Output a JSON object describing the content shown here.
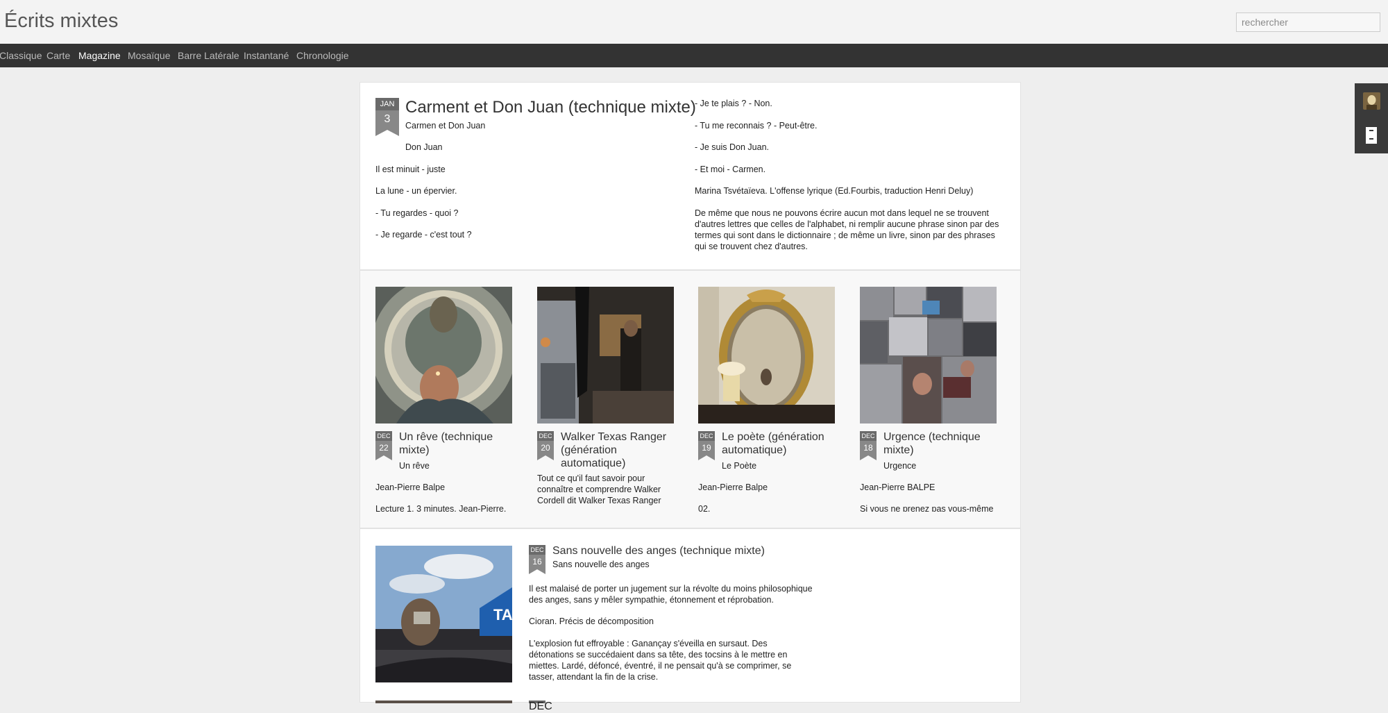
{
  "header": {
    "site_title": "Écrits mixtes",
    "search_placeholder": "rechercher"
  },
  "nav": [
    {
      "label": "Classique",
      "active": false
    },
    {
      "label": "Carte",
      "active": false
    },
    {
      "label": "Magazine",
      "active": true
    },
    {
      "label": "Mosaïque",
      "active": false
    },
    {
      "label": "Barre Latérale",
      "active": false
    },
    {
      "label": "Instantané",
      "active": false
    },
    {
      "label": "Chronologie",
      "active": false
    }
  ],
  "featured": {
    "month": "JAN",
    "day": "3",
    "title": "Carment et Don Juan (technique mixte)",
    "subtitle": "Carmen et Don Juan",
    "left_paragraphs": [
      "Don Juan",
      "Il est minuit - juste",
      "La lune - un épervier.",
      "- Tu regardes - quoi ?",
      "- Je regarde - c'est tout ?"
    ],
    "right_paragraphs": [
      "- Je te plais ? - Non.",
      "- Tu me reconnais ? - Peut-être.",
      "- Je suis Don Juan.",
      "- Et moi - Carmen.",
      "Marina Tsvétaïeva. L'offense lyrique (Ed.Fourbis, traduction Henri Deluy)",
      "De même que nous ne pouvons écrire aucun mot dans lequel ne se trouvent d'autres lettres que celles de l'alphabet, ni remplir aucune phrase sinon par des termes qui sont dans le dictionnaire ; de même un livre, sinon par des phrases qui se trouvent chez d'autres."
    ]
  },
  "grid_posts": [
    {
      "month": "DEC",
      "day": "22",
      "title": "Un rêve (technique mixte)",
      "subtitle": "Un rêve",
      "paragraphs": [
        "Jean-Pierre Balpe",
        "Lecture 1. 3 minutes. Jean-Pierre."
      ]
    },
    {
      "month": "DEC",
      "day": "20",
      "title": "Walker Texas Ranger (génération automatique)",
      "subtitle": "",
      "paragraphs": [
        "Tout ce qu'il faut savoir pour connaître et comprendre Walker Cordell dit Walker Texas Ranger"
      ]
    },
    {
      "month": "DEC",
      "day": "19",
      "title": "Le poète (génération automatique)",
      "subtitle": "Le Poète",
      "paragraphs": [
        "Jean-Pierre Balpe",
        "02."
      ]
    },
    {
      "month": "DEC",
      "day": "18",
      "title": "Urgence (technique mixte)",
      "subtitle": "Urgence",
      "paragraphs": [
        "Jean-Pierre BALPE",
        "Si vous ne prenez pas vous-même"
      ]
    }
  ],
  "list_post": {
    "month": "DEC",
    "day": "16",
    "title": "Sans nouvelle des anges (technique mixte)",
    "subtitle": "Sans nouvelle des anges",
    "paragraphs": [
      "Il est malaisé de porter un jugement sur la révolte du moins philosophique des anges, sans y mêler sympathie, étonnement et réprobation.",
      "Cioran. Précis de décomposition",
      "L'explosion fut effroyable : Ganançay s'éveilla en sursaut. Des détonations se succédaient dans sa tête, des tocsins à le mettre en miettes. Lardé, défoncé, éventré, il ne pensait qu'à se comprimer, se tasser, attendant la fin de la crise."
    ],
    "photo_sign_text": "TA"
  },
  "next_post": {
    "month": "DEC"
  }
}
